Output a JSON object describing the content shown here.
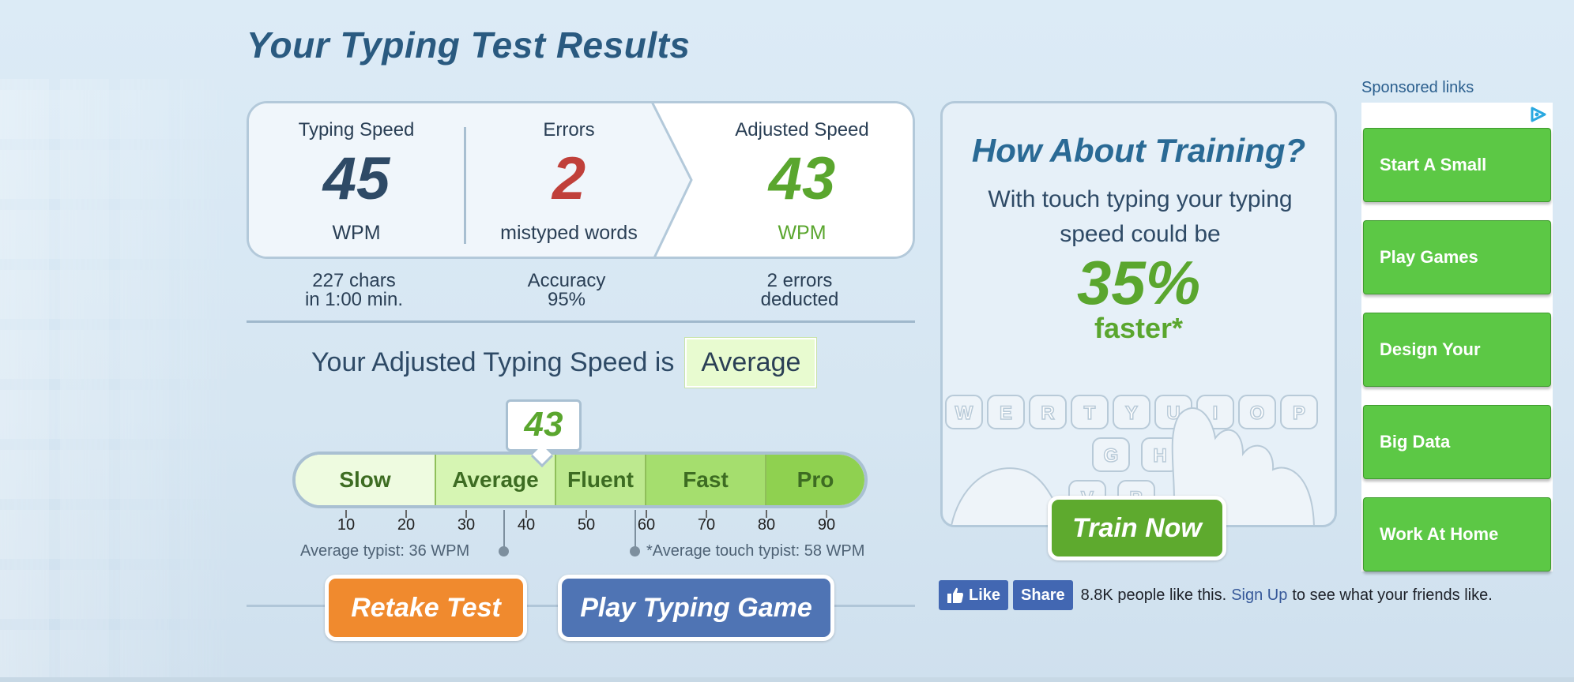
{
  "title": "Your Typing Test Results",
  "stats": {
    "typing_speed": {
      "label": "Typing Speed",
      "value": "45",
      "unit": "WPM",
      "color": "#2e4a66"
    },
    "errors": {
      "label": "Errors",
      "value": "2",
      "unit": "mistyped words",
      "color": "#c0403a"
    },
    "adjusted": {
      "label": "Adjusted Speed",
      "value": "43",
      "unit": "WPM",
      "color": "#5aa62e"
    }
  },
  "sub_stats": {
    "chars_line1": "227 chars",
    "chars_line2": "in 1:00 min.",
    "accuracy_line1": "Accuracy",
    "accuracy_line2": "95%",
    "deducted_line1": "2 errors",
    "deducted_line2": "deducted"
  },
  "adjusted_rating": {
    "prefix": "Your Adjusted Typing Speed is",
    "rating": "Average"
  },
  "scale": {
    "score": "43",
    "segments": [
      {
        "label": "Slow",
        "color": "#eefbe0"
      },
      {
        "label": "Average",
        "color": "#d6f5b3"
      },
      {
        "label": "Fluent",
        "color": "#bde98f"
      },
      {
        "label": "Fast",
        "color": "#a5de6e"
      },
      {
        "label": "Pro",
        "color": "#8fd150"
      }
    ],
    "ticks": [
      "10",
      "20",
      "30",
      "40",
      "50",
      "60",
      "70",
      "80",
      "90"
    ],
    "average_typist": "Average typist: 36 WPM",
    "touch_typist": "*Average touch typist: 58 WPM"
  },
  "buttons": {
    "retake": "Retake Test",
    "play_game": "Play Typing Game"
  },
  "training": {
    "title": "How About Training?",
    "text": "With touch typing your typing speed could be",
    "percent": "35%",
    "faster": "faster*",
    "button": "Train Now",
    "keys_row1": [
      "W",
      "E",
      "R",
      "T",
      "Y",
      "U",
      "I",
      "O",
      "P"
    ],
    "keys_row2": [
      "G",
      "H"
    ],
    "keys_row3": [
      "V",
      "B"
    ]
  },
  "facebook": {
    "like": "Like",
    "share": "Share",
    "text": "8.8K people like this.",
    "signup": "Sign Up",
    "suffix": "to see what your friends like."
  },
  "ads": {
    "label": "Sponsored links",
    "items": [
      "Start A Small",
      "Play Games",
      "Design Your",
      "Big Data",
      "Work At Home"
    ]
  },
  "colors": {
    "orange": "#f08a2e",
    "blue": "#4f74b4",
    "green": "#5eaa2e",
    "ad_green": "#5cc845"
  }
}
